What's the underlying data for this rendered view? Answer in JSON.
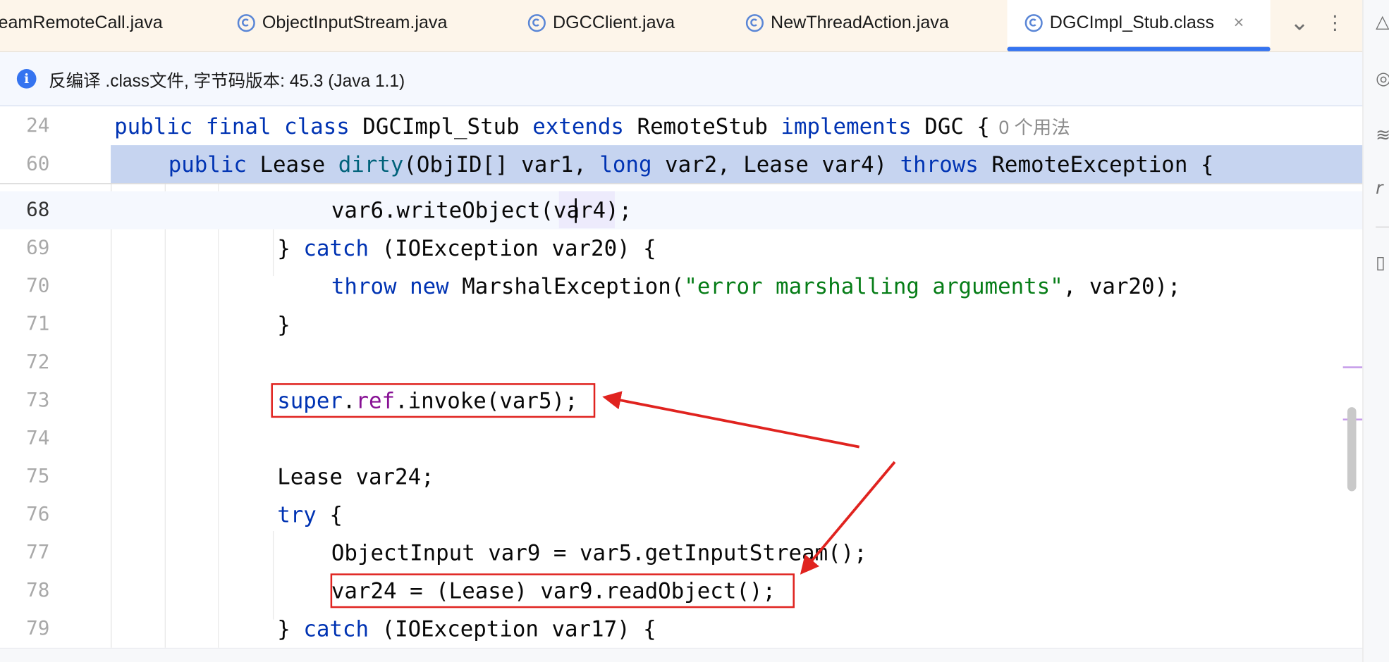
{
  "tabs": [
    {
      "label": "eamRemoteCall.java",
      "icon": "java-class-icon",
      "active": false
    },
    {
      "label": "ObjectInputStream.java",
      "icon": "java-class-icon",
      "active": false
    },
    {
      "label": "DGCClient.java",
      "icon": "java-class-icon",
      "active": false
    },
    {
      "label": "NewThreadAction.java",
      "icon": "java-class-icon",
      "active": false
    },
    {
      "label": "DGCImpl_Stub.class",
      "icon": "java-class-icon",
      "active": true
    }
  ],
  "tab_close_glyph": "×",
  "toolbar": {
    "dropdown_glyph": "⌄",
    "more_glyph": "⋮"
  },
  "banner": {
    "text": "反编译 .class文件, 字节码版本: 45.3 (Java 1.1)"
  },
  "sticky": {
    "l24": {
      "num": "24",
      "kw1": "public",
      "kw2": "final",
      "kw3": "class",
      "name": "DGCImpl_Stub",
      "kw4": "extends",
      "base": "RemoteStub",
      "kw5": "implements",
      "iface": "DGC {",
      "hint": "0 个用法"
    },
    "l60": {
      "num": "60",
      "kw1": "public",
      "type": "Lease",
      "method": "dirty",
      "p1": "(ObjID[] var1, ",
      "kw2": "long",
      "p2": " var2, Lease var4) ",
      "kw3": "throws",
      "rest": " RemoteException {"
    }
  },
  "lines": {
    "l68": {
      "num": "68",
      "text": "var6.writeObject(var4);"
    },
    "l69": {
      "num": "69",
      "pre": "} ",
      "kw": "catch",
      "post": " (IOException var20) {"
    },
    "l70": {
      "num": "70",
      "kw1": "throw",
      "kw2": "new",
      "mid": " MarshalException(",
      "str": "\"error marshalling arguments\"",
      "post": ", var20);"
    },
    "l71": {
      "num": "71",
      "text": "}"
    },
    "l72": {
      "num": "72"
    },
    "l73": {
      "num": "73",
      "kw": "super",
      "dot": ".",
      "field": "ref",
      "post": ".invoke(var5);"
    },
    "l74": {
      "num": "74"
    },
    "l75": {
      "num": "75",
      "text": "Lease var24;"
    },
    "l76": {
      "num": "76",
      "kw": "try",
      "post": " {"
    },
    "l77": {
      "num": "77",
      "text": "ObjectInput var9 = var5.getInputStream();"
    },
    "l78": {
      "num": "78",
      "text": "var24 = (Lease) var9.readObject();"
    },
    "l79": {
      "num": "79",
      "pre": "} ",
      "kw": "catch",
      "post": " (IOException var17) {"
    }
  },
  "colors": {
    "keyword": "#0033b3",
    "method": "#00627a",
    "field": "#871094",
    "string": "#067d17",
    "annotation_red": "#e0231f",
    "accent": "#3574f0"
  }
}
